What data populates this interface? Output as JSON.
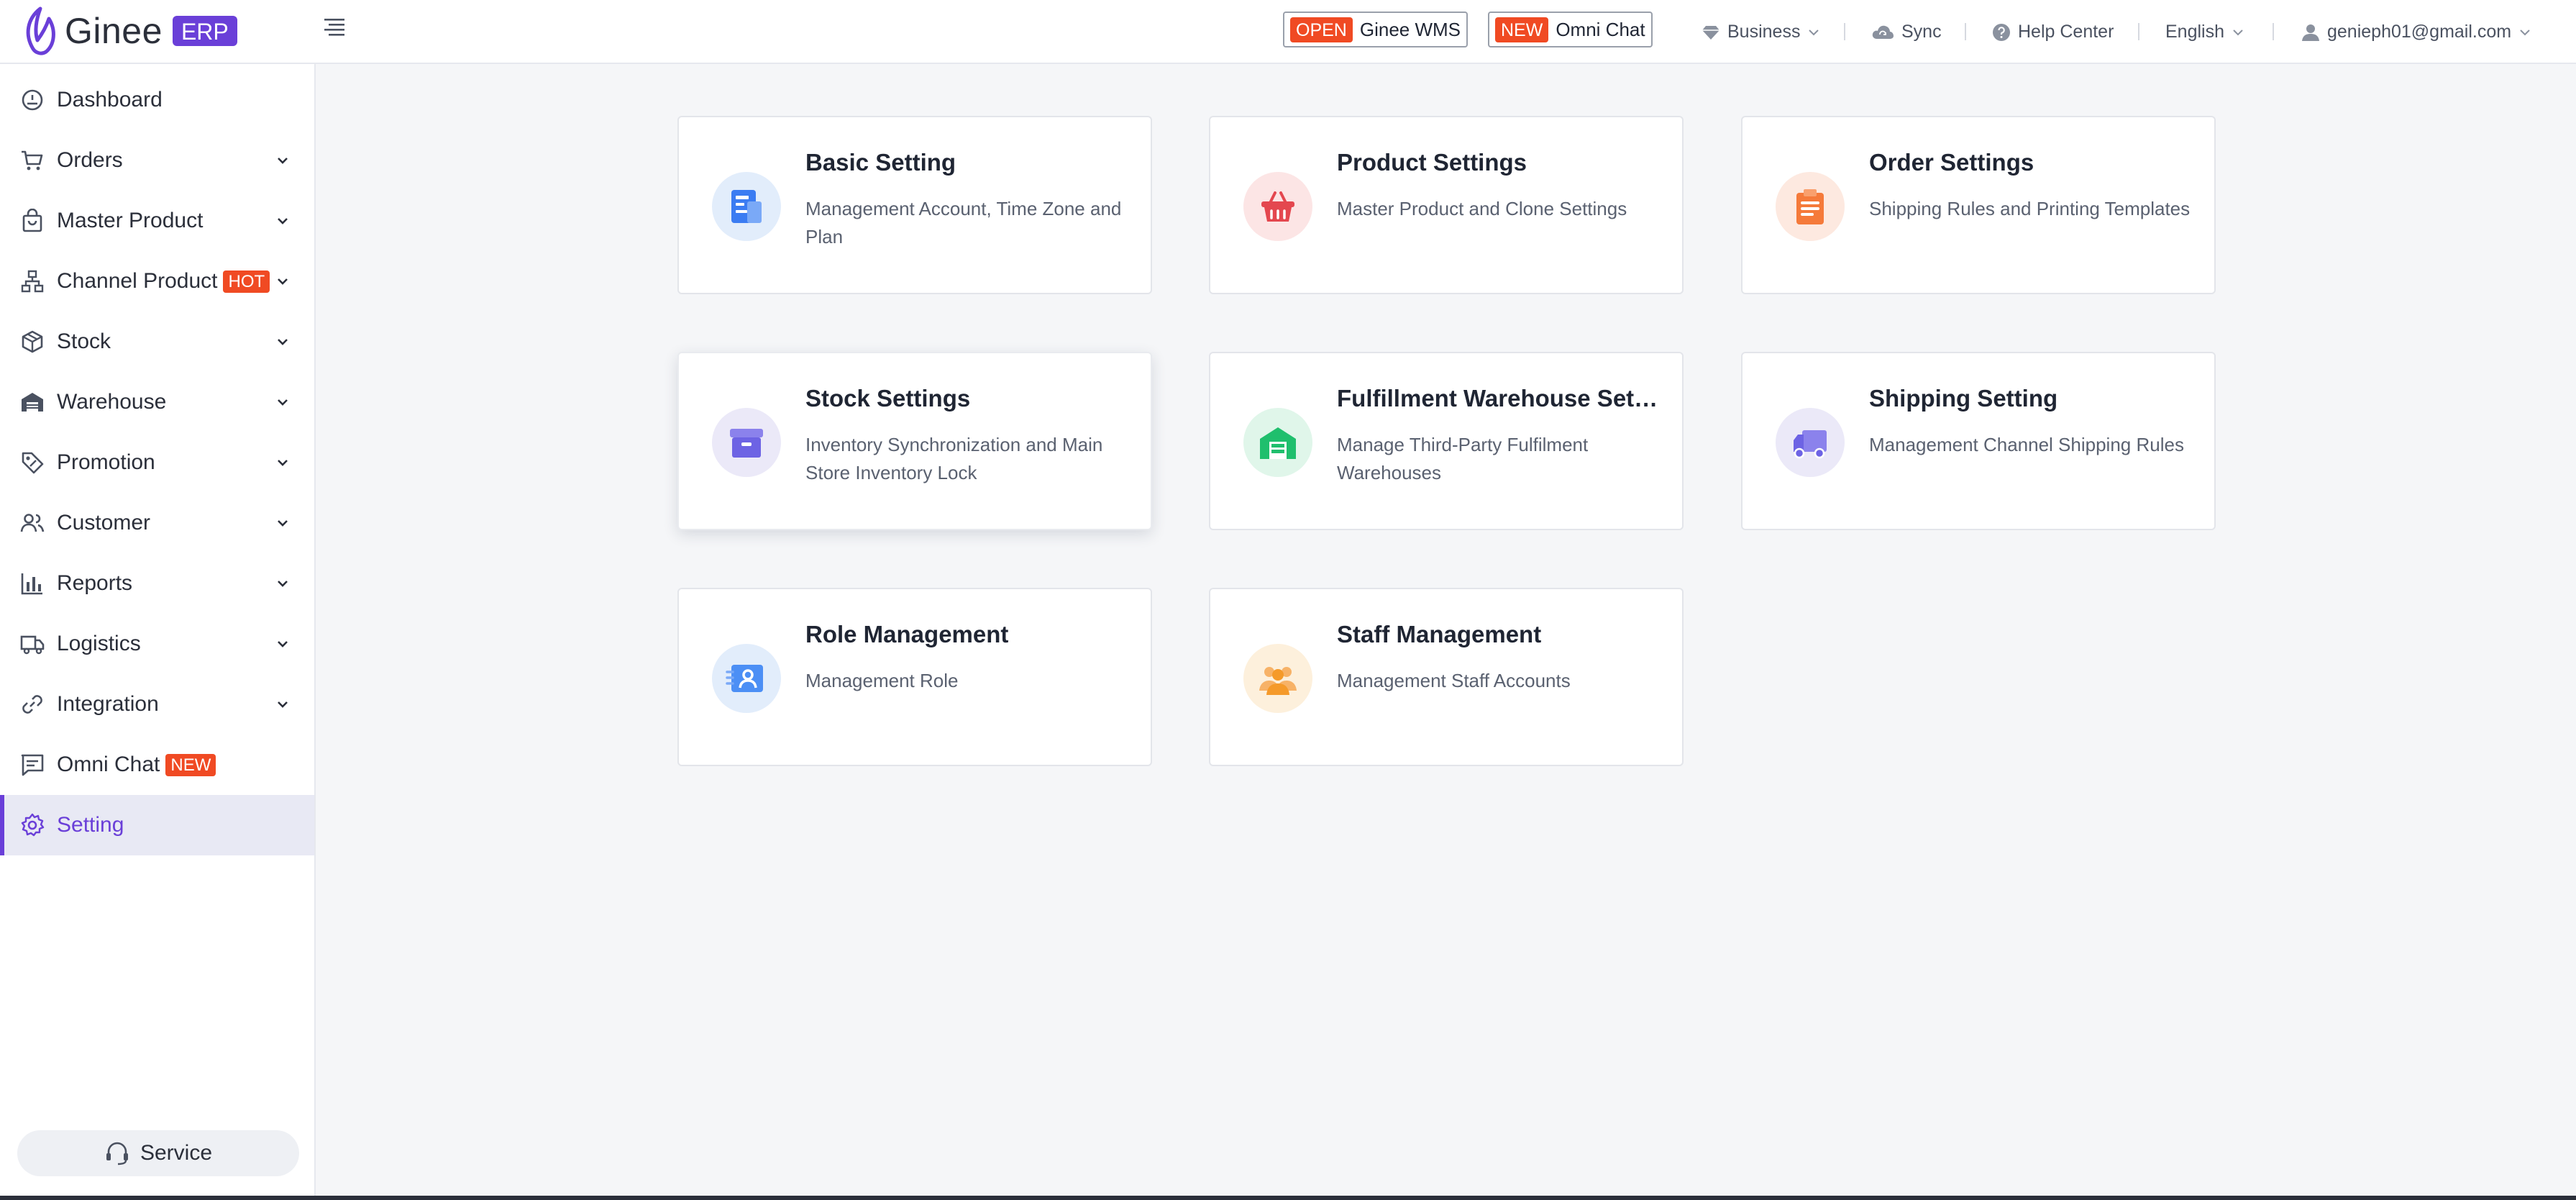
{
  "brand": {
    "name": "Ginee",
    "badge": "ERP",
    "accent": "#6a3fd8"
  },
  "header": {
    "wms": {
      "tag": "OPEN",
      "label": "Ginee WMS"
    },
    "omni": {
      "tag": "NEW",
      "label": "Omni Chat"
    },
    "business": "Business",
    "sync": "Sync",
    "help": "Help Center",
    "language": "English",
    "account": "genieph01@gmail.com"
  },
  "sidebar": {
    "items": [
      {
        "label": "Dashboard"
      },
      {
        "label": "Orders"
      },
      {
        "label": "Master Product"
      },
      {
        "label": "Channel Product",
        "badge": "HOT"
      },
      {
        "label": "Stock"
      },
      {
        "label": "Warehouse"
      },
      {
        "label": "Promotion"
      },
      {
        "label": "Customer"
      },
      {
        "label": "Reports"
      },
      {
        "label": "Logistics"
      },
      {
        "label": "Integration"
      },
      {
        "label": "Omni Chat",
        "badge": "NEW"
      },
      {
        "label": "Setting"
      }
    ],
    "service": "Service"
  },
  "cards": [
    {
      "title": "Basic Setting",
      "desc": "Management Account, Time Zone and Plan",
      "icon": "document-icon"
    },
    {
      "title": "Product Settings",
      "desc": "Master Product and Clone Settings",
      "icon": "basket-icon"
    },
    {
      "title": "Order Settings",
      "desc": "Shipping Rules and Printing Templates",
      "icon": "clipboard-icon"
    },
    {
      "title": "Stock Settings",
      "desc": "Inventory Synchronization and Main Store Inventory Lock",
      "icon": "archive-box-icon"
    },
    {
      "title": "Fulfillment Warehouse Sett...",
      "desc": "Manage Third-Party Fulfilment Warehouses",
      "icon": "warehouse-icon"
    },
    {
      "title": "Shipping Setting",
      "desc": "Management Channel Shipping Rules",
      "icon": "truck-icon"
    },
    {
      "title": "Role Management",
      "desc": "Management Role",
      "icon": "id-card-icon"
    },
    {
      "title": "Staff Management",
      "desc": "Management Staff Accounts",
      "icon": "people-icon"
    }
  ]
}
